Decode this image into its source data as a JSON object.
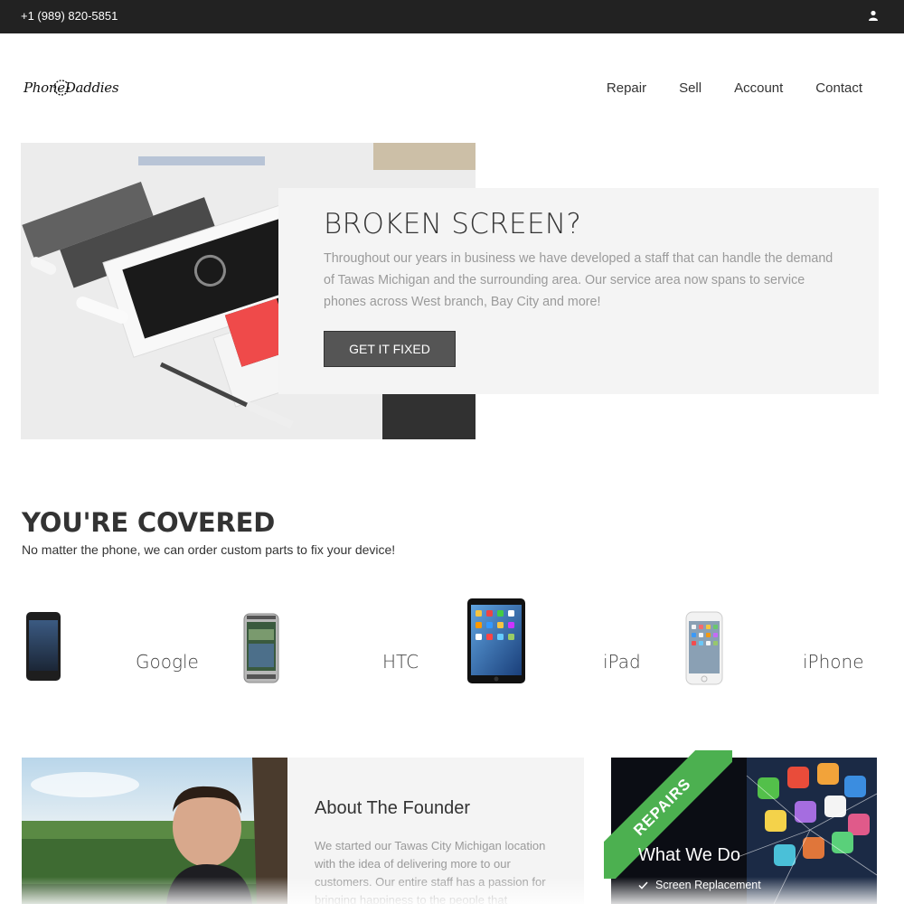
{
  "topbar": {
    "phone": "+1 (989) 820-5851",
    "user_icon": "user-icon"
  },
  "header": {
    "logo_text": "PhoneDaddies",
    "nav": [
      {
        "label": "Repair"
      },
      {
        "label": "Sell"
      },
      {
        "label": "Account"
      },
      {
        "label": "Contact"
      }
    ]
  },
  "hero": {
    "title": "BROKEN SCREEN?",
    "body": "Throughout our years in business we have developed a staff that can handle the demand of Tawas Michigan and the surrounding area. Our service area now spans to service phones across West branch, Bay City and more!",
    "button": "GET IT FIXED"
  },
  "covered": {
    "title": "YOU'RE COVERED",
    "subtitle": "No matter the phone, we can order custom parts to fix your device!",
    "brands": [
      {
        "label": "Google"
      },
      {
        "label": "HTC"
      },
      {
        "label": "iPad"
      },
      {
        "label": "iPhone"
      }
    ]
  },
  "founder": {
    "title": "About The Founder",
    "body": "We started our Tawas City Michigan location with the idea of delivering more to our customers. Our entire staff has a passion for bringing happiness to the people that"
  },
  "repairs": {
    "ribbon": "REPAIRS",
    "title": "What We Do",
    "items": [
      {
        "label": "Screen Replacement"
      }
    ]
  },
  "colors": {
    "topbar": "#222222",
    "ribbon": "#4cb050",
    "button": "#555555",
    "card": "#f4f4f4"
  }
}
